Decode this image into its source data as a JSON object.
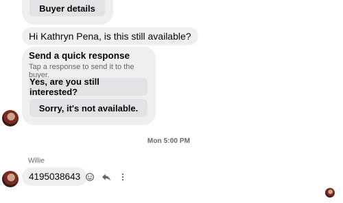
{
  "top_card": {
    "buyer_button_label": "Buyer details"
  },
  "messages": [
    {
      "text": "Hi Kathryn Pena, is this still available?"
    }
  ],
  "quick_response": {
    "title": "Send a quick response",
    "subtitle": "Tap a response to send it to the buyer.",
    "options": [
      "Yes, are you still interested?",
      "Sorry, it's not available."
    ]
  },
  "timestamp": "Mon 5:00 PM",
  "last_message": {
    "sender": "Willie",
    "text": "4195038643"
  },
  "icons": {
    "react": "smile-icon",
    "reply": "reply-icon",
    "more": "more-vertical-icon"
  },
  "colors": {
    "bubble": "#efefef",
    "button": "#e2e3e5",
    "secondary_text": "#65676b"
  }
}
